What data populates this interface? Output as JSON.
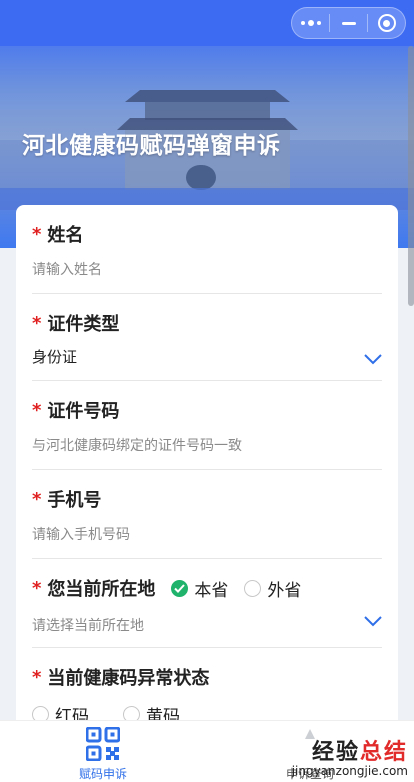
{
  "page": {
    "title": "河北健康码赋码弹窗申诉"
  },
  "form": {
    "name": {
      "label": "姓名",
      "placeholder": "请输入姓名"
    },
    "id_type": {
      "label": "证件类型",
      "value": "身份证"
    },
    "id_number": {
      "label": "证件号码",
      "placeholder": "与河北健康码绑定的证件号码一致"
    },
    "phone": {
      "label": "手机号",
      "placeholder": "请输入手机号码"
    },
    "location": {
      "label": "您当前所在地",
      "options": [
        {
          "label": "本省",
          "selected": true
        },
        {
          "label": "外省",
          "selected": false
        }
      ],
      "placeholder": "请选择当前所在地"
    },
    "code_status": {
      "label": "当前健康码异常状态",
      "options": [
        {
          "label": "红码",
          "selected": false
        },
        {
          "label": "黄码",
          "selected": false
        }
      ]
    },
    "required_mark": "*"
  },
  "bottom_nav": {
    "items": [
      {
        "label": "赋码申诉",
        "icon": "qr-code-icon",
        "active": true
      },
      {
        "label": "申诉查询",
        "icon": "query-icon",
        "active": false
      }
    ]
  },
  "watermark": {
    "main_black": "经验",
    "main_red": "总结",
    "sub": "jingyanzongjie.com"
  },
  "colors": {
    "primary": "#3d6cf3",
    "required": "#e02020",
    "radio_checked": "#1fb36b",
    "nav_active": "#2f6fe8"
  }
}
